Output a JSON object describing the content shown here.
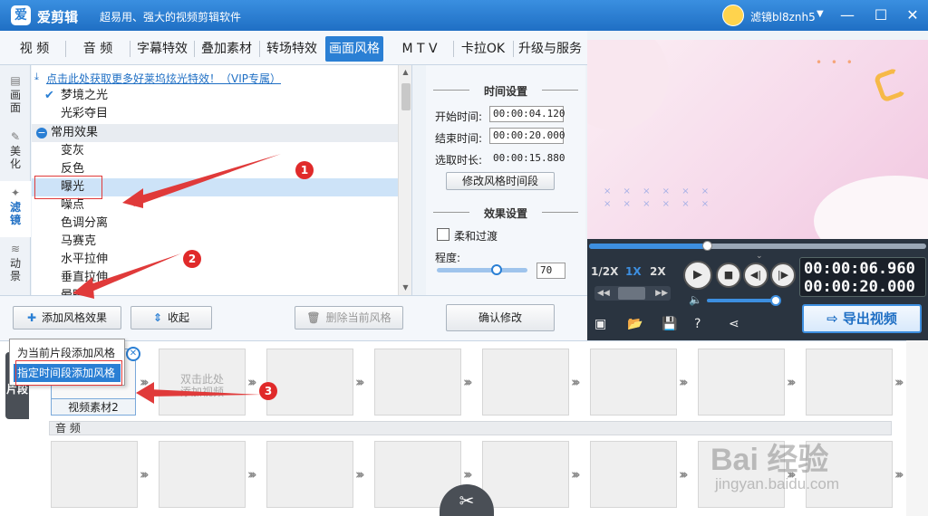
{
  "titlebar": {
    "logo_glyph": "爱",
    "app_name": "爱剪辑",
    "slogan": "超易用、强大的视频剪辑软件",
    "username": "滤镜bl8znh5",
    "minimize": "—",
    "maximize": "☐",
    "close": "✕"
  },
  "main_tabs": [
    {
      "label": "视  频"
    },
    {
      "label": "音  频"
    },
    {
      "label": "字幕特效"
    },
    {
      "label": "叠加素材"
    },
    {
      "label": "转场特效"
    },
    {
      "label": "画面风格"
    },
    {
      "label": "M T V"
    },
    {
      "label": "卡拉OK"
    },
    {
      "label": "升级与服务"
    }
  ],
  "side_tabs": [
    {
      "label": "画面",
      "icon": "▤"
    },
    {
      "label": "美化",
      "icon": "✎"
    },
    {
      "label": "滤镜",
      "icon": "✦"
    },
    {
      "label": "动景",
      "icon": "≋"
    }
  ],
  "filter_list": {
    "promo": "点击此处获取更多好莱坞炫光特效！（VIP专属）",
    "items": [
      {
        "label": "梦境之光",
        "checked": "✔"
      },
      {
        "label": "光彩夺目"
      }
    ],
    "group": "常用效果",
    "group_items": [
      {
        "label": "变灰"
      },
      {
        "label": "反色"
      },
      {
        "label": "曝光"
      },
      {
        "label": "噪点"
      },
      {
        "label": "色调分离"
      },
      {
        "label": "马赛克"
      },
      {
        "label": "水平拉伸"
      },
      {
        "label": "垂直拉伸"
      },
      {
        "label": "晕眩"
      }
    ],
    "selected_index": 2
  },
  "settings": {
    "time_title": "时间设置",
    "start_label": "开始时间:",
    "start_value": "00:00:04.120",
    "end_label": "结束时间:",
    "end_value": "00:00:20.000",
    "duration_label": "选取时长:",
    "duration_value": "00:00:15.880",
    "modify_time_btn": "修改风格时间段",
    "effect_title": "效果设置",
    "soft_transition": "柔和过渡",
    "degree_label": "程度:",
    "degree_value": "70",
    "degree_fraction": 0.7,
    "confirm_btn": "确认修改"
  },
  "actions": {
    "add_effect": "添加风格效果",
    "collapse": "收起",
    "delete_effect": "删除当前风格"
  },
  "context_menu": {
    "item1": "为当前片段添加风格",
    "item2": "指定时间段添加风格"
  },
  "player": {
    "progress_fraction": 0.35,
    "speed_half": "1/2X",
    "speed_1x": "1X",
    "speed_2x": "2X",
    "current_time": "00:00:06.960",
    "total_time": "00:00:20.000",
    "export_label": "导出视频",
    "volume_fraction": 0.95
  },
  "timeline": {
    "side_label": "片段",
    "clip_label": "视频素材2",
    "empty_hint": "双击此处\n添加视频",
    "audio_label": "音 频"
  },
  "annotations": {
    "n1": "1",
    "n2": "2",
    "n3": "3"
  },
  "watermark": {
    "brand": "Bai 经验",
    "url": "jingyan.baidu.com"
  },
  "colors": {
    "accent": "#2a7fd4",
    "titlebar": "#1f6fc4",
    "annotation": "#e03a3a"
  }
}
